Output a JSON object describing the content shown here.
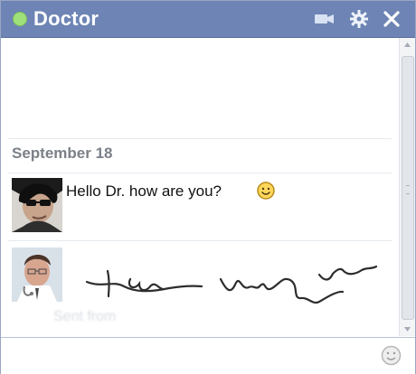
{
  "header": {
    "title": "Doctor",
    "status": "online"
  },
  "chat": {
    "date": "September 18",
    "messages": [
      {
        "text": "Hello Dr. how are you?"
      }
    ],
    "sent_status": "Sent from"
  },
  "colors": {
    "titlebar": "#6d84b4",
    "online": "#9fe07a"
  },
  "icons": {
    "video": "video-camera",
    "settings": "gear",
    "close": "x",
    "emoji": "smiley"
  }
}
